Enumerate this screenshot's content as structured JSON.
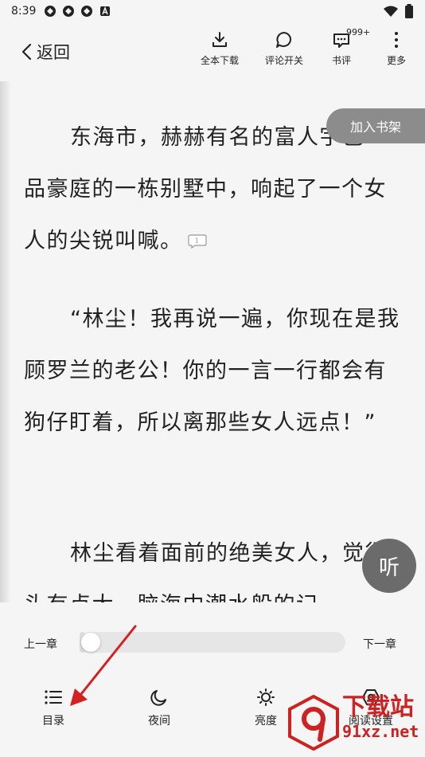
{
  "status_bar": {
    "time": "8:39"
  },
  "top_bar": {
    "back_label": "返回",
    "actions": [
      {
        "label": "全本下载",
        "icon": "download-icon"
      },
      {
        "label": "评论开关",
        "icon": "comment-toggle-icon"
      },
      {
        "label": "书评",
        "icon": "review-icon",
        "badge": "999+"
      },
      {
        "label": "更多",
        "icon": "more-vertical-icon"
      }
    ]
  },
  "reader": {
    "paragraphs": [
      {
        "text": "东海市，赫赫有名的富人宇巴一品豪庭的一栋别墅中，响起了一个女人的尖锐叫喊。",
        "comment_count": "1"
      },
      {
        "text": "“林尘！我再说一遍，你现在是我顾罗兰的老公！你的一言一行都会有狗仔盯着，所以离那些女人远点！”"
      },
      {
        "text": "林尘看着面前的绝美女人，觉得头有点大，脑海中潮水般的记"
      }
    ]
  },
  "floating": {
    "add_bookshelf": "加入书架",
    "listen": "听"
  },
  "bottom": {
    "prev_chapter": "上一章",
    "next_chapter": "下一章",
    "progress": 0.02,
    "actions": [
      {
        "label": "目录",
        "icon": "list-icon"
      },
      {
        "label": "夜间",
        "icon": "moon-icon"
      },
      {
        "label": "亮度",
        "icon": "brightness-icon"
      },
      {
        "label": "阅读设置",
        "icon": "settings-icon"
      }
    ]
  },
  "watermark": {
    "top": "下载站",
    "bottom": "91xz.net"
  },
  "colors": {
    "background": "#f5f5f5",
    "arrow": "#d42020",
    "watermark": "#cc2222",
    "floating_button": "#8c8c8c"
  }
}
